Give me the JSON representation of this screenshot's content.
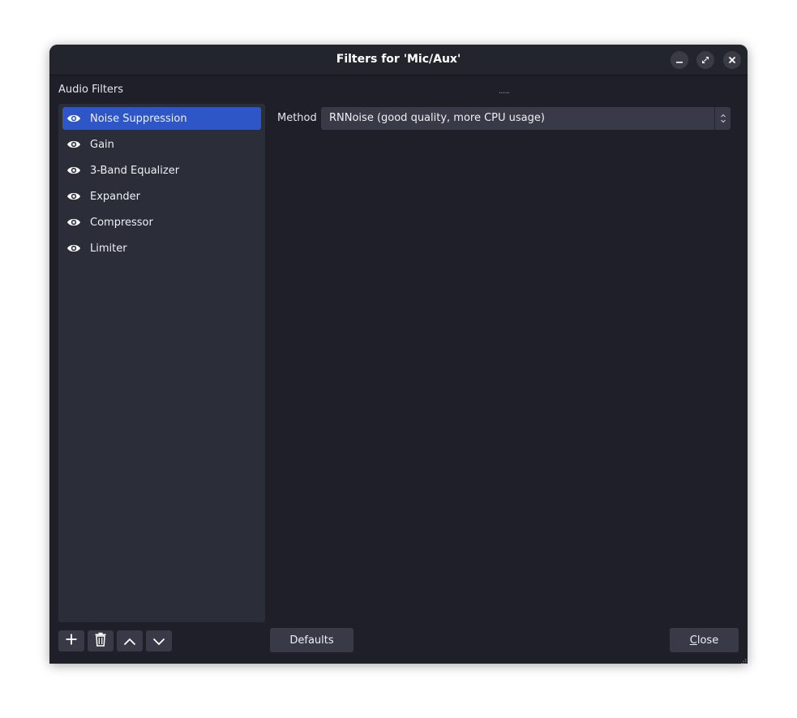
{
  "window": {
    "title": "Filters for 'Mic/Aux'"
  },
  "titlebar_buttons": {
    "minimize_icon": "minimize-icon",
    "maximize_icon": "maximize-icon",
    "close_icon": "close-icon"
  },
  "sidebar": {
    "section_label": "Audio Filters",
    "items": [
      {
        "label": "Noise Suppression",
        "visible": true,
        "selected": true
      },
      {
        "label": "Gain",
        "visible": true,
        "selected": false
      },
      {
        "label": "3-Band Equalizer",
        "visible": true,
        "selected": false
      },
      {
        "label": "Expander",
        "visible": true,
        "selected": false
      },
      {
        "label": "Compressor",
        "visible": true,
        "selected": false
      },
      {
        "label": "Limiter",
        "visible": true,
        "selected": false
      }
    ]
  },
  "splitter": {
    "handle": "......"
  },
  "properties": {
    "method_label": "Method",
    "method_value": "RNNoise (good quality, more CPU usage)"
  },
  "footer": {
    "defaults_label": "Defaults",
    "close_label": "Close",
    "close_mnemonic": "C",
    "close_rest": "lose"
  },
  "colors": {
    "accent": "#2f56c6",
    "window_bg": "#1e1f29",
    "panel_bg": "#2b2e38",
    "button_bg": "#383b47"
  }
}
